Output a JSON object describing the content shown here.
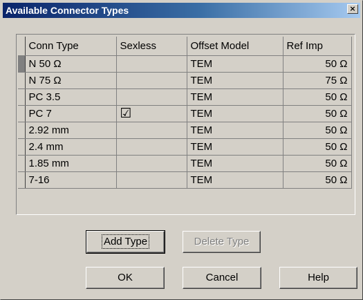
{
  "window": {
    "title": "Available Connector Types",
    "close_glyph": "×"
  },
  "grid": {
    "columns": [
      "Conn Type",
      "Sexless",
      "Offset Model",
      "Ref Imp"
    ],
    "rows": [
      {
        "conn_type": "N 50 Ω",
        "sexless": "",
        "offset_model": "TEM",
        "ref_imp": "50 Ω"
      },
      {
        "conn_type": "N 75 Ω",
        "sexless": "",
        "offset_model": "TEM",
        "ref_imp": "75 Ω"
      },
      {
        "conn_type": "PC 3.5",
        "sexless": "",
        "offset_model": "TEM",
        "ref_imp": "50 Ω"
      },
      {
        "conn_type": "PC 7",
        "sexless": "☑",
        "offset_model": "TEM",
        "ref_imp": "50 Ω"
      },
      {
        "conn_type": "2.92 mm",
        "sexless": "",
        "offset_model": "TEM",
        "ref_imp": "50 Ω"
      },
      {
        "conn_type": "2.4 mm",
        "sexless": "",
        "offset_model": "TEM",
        "ref_imp": "50 Ω"
      },
      {
        "conn_type": "1.85 mm",
        "sexless": "",
        "offset_model": "TEM",
        "ref_imp": "50 Ω"
      },
      {
        "conn_type": "7-16",
        "sexless": "",
        "offset_model": "TEM",
        "ref_imp": "50 Ω"
      }
    ],
    "selected_row": 0
  },
  "buttons": {
    "add_type": "Add Type",
    "delete_type": "Delete Type",
    "ok": "OK",
    "cancel": "Cancel",
    "help": "Help"
  }
}
